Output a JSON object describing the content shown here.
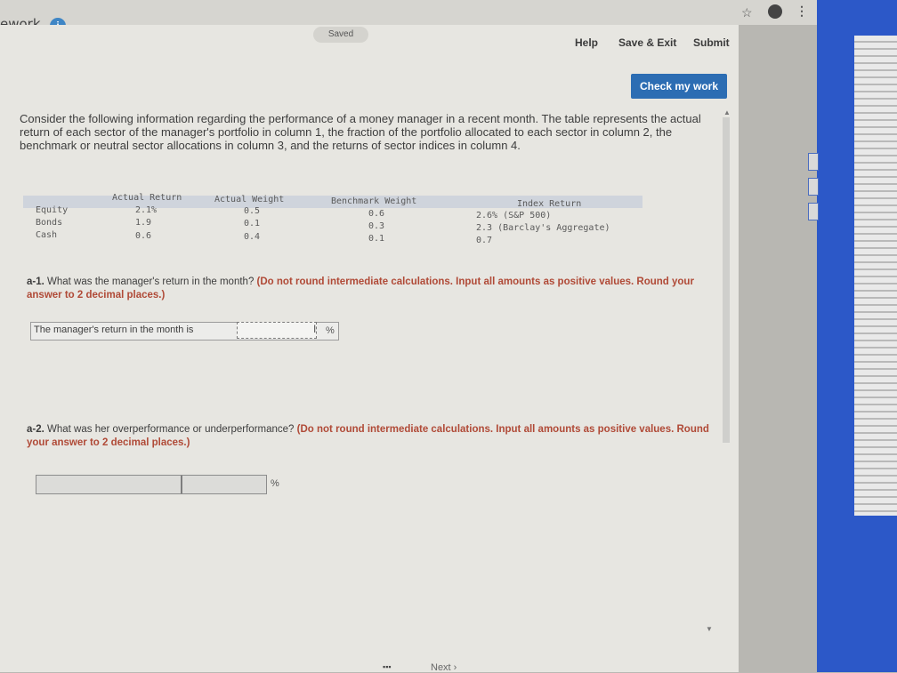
{
  "header": {
    "brand": "ework",
    "info_icon": "info-icon",
    "saved": "Saved",
    "help": "Help",
    "save_exit": "Save & Exit",
    "submit": "Submit",
    "check": "Check my work"
  },
  "browser": {
    "star_icon": "star-icon",
    "profile_icon": "profile-icon",
    "menu_icon": "kebab-menu-icon",
    "star": "☆",
    "menu": "⋮"
  },
  "intro": "Consider the following information regarding the performance of a money manager in a recent month. The table represents the actual return of each sector of the manager's portfolio in column 1, the fraction of the portfolio allocated to each sector in column 2, the benchmark or neutral sector allocations in column 3, and the returns of sector indices in column 4.",
  "table": {
    "headers": [
      "Actual Return",
      "Actual Weight",
      "Benchmark Weight",
      "Index Return"
    ],
    "rows": [
      {
        "label": "Equity",
        "actual_return": "2.1%",
        "actual_weight": "0.5",
        "benchmark_weight": "0.6",
        "index_return": "2.6% (S&P 500)"
      },
      {
        "label": "Bonds",
        "actual_return": "1.9",
        "actual_weight": "0.1",
        "benchmark_weight": "0.3",
        "index_return": "2.3 (Barclay's Aggregate)"
      },
      {
        "label": "Cash",
        "actual_return": "0.6",
        "actual_weight": "0.4",
        "benchmark_weight": "0.1",
        "index_return": "0.7"
      }
    ]
  },
  "q1": {
    "prefix": "a-1.",
    "text": " What was the manager's return in the month? ",
    "instruction": "(Do not round intermediate calculations. Input all amounts as positive values. Round your answer to 2 decimal places.)",
    "label": "The manager's return in the month is",
    "value": "",
    "unit": "%"
  },
  "q2": {
    "prefix": "a-2.",
    "text": " What was her overperformance or underperformance? ",
    "instruction": "(Do not round intermediate calculations. Input all amounts as positive values. Round your answer to 2 decimal places.)",
    "value": "",
    "unit": "%"
  },
  "footer": {
    "next": "Next ›",
    "pages": "▪▪▪"
  }
}
